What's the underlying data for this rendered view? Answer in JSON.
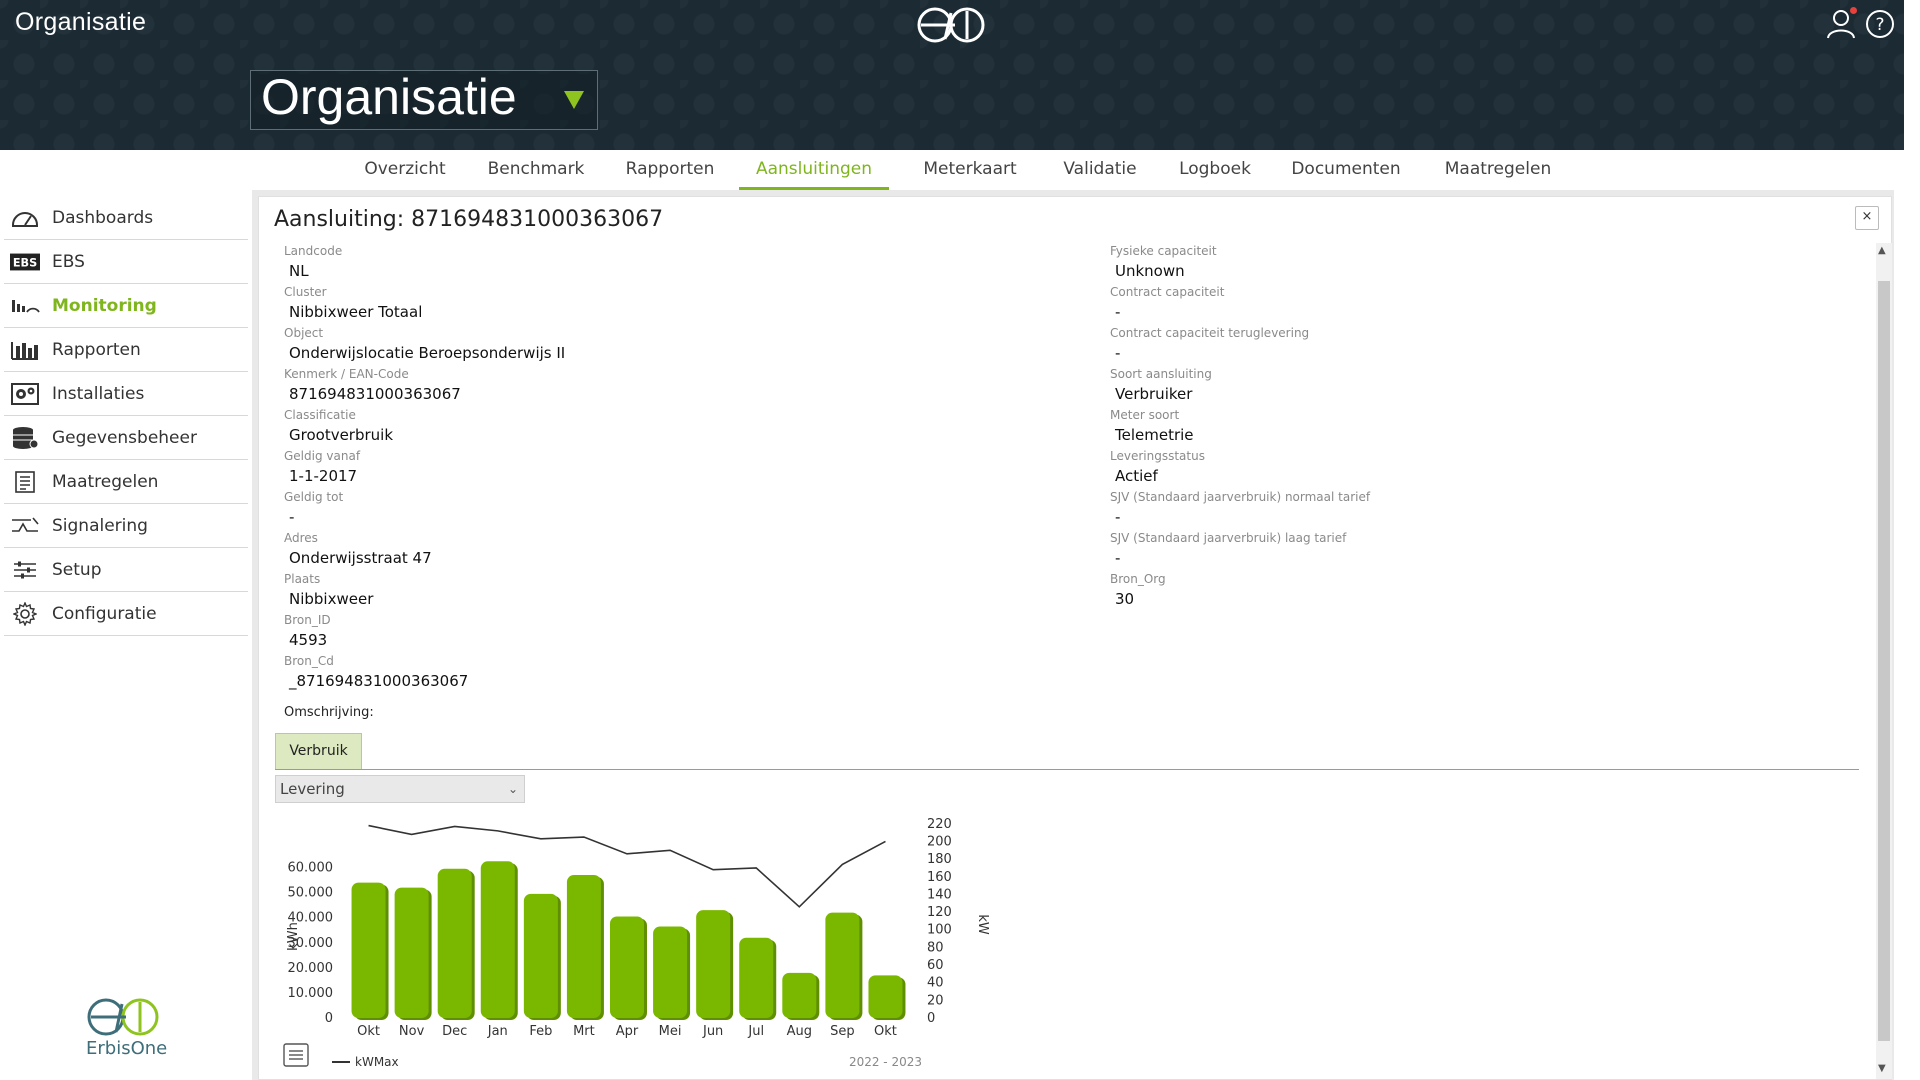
{
  "app": {
    "title": "Organisatie"
  },
  "org_selector": {
    "label": "Organisatie"
  },
  "colors": {
    "accent": "#7fb51d",
    "header_bg": "#1b2a33",
    "bar_green": "#7ab800"
  },
  "tabs": [
    {
      "label": "Overzicht"
    },
    {
      "label": "Benchmark"
    },
    {
      "label": "Rapporten"
    },
    {
      "label": "Aansluitingen",
      "active": true
    },
    {
      "label": "Meterkaart"
    },
    {
      "label": "Validatie"
    },
    {
      "label": "Logboek"
    },
    {
      "label": "Documenten"
    },
    {
      "label": "Maatregelen"
    }
  ],
  "sidebar": {
    "items": [
      {
        "label": "Dashboards",
        "icon": "gauge-icon"
      },
      {
        "label": "EBS",
        "icon": "ebs-icon"
      },
      {
        "label": "Monitoring",
        "icon": "monitoring-icon",
        "active": true
      },
      {
        "label": "Rapporten",
        "icon": "bar-chart-icon"
      },
      {
        "label": "Installaties",
        "icon": "installation-icon"
      },
      {
        "label": "Gegevensbeheer",
        "icon": "database-icon"
      },
      {
        "label": "Maatregelen",
        "icon": "checklist-icon"
      },
      {
        "label": "Signalering",
        "icon": "signal-icon"
      },
      {
        "label": "Setup",
        "icon": "sliders-icon"
      },
      {
        "label": "Configuratie",
        "icon": "gear-icon"
      }
    ],
    "brand": "ErbisOne"
  },
  "panel": {
    "title": "Aansluiting: 871694831000363067",
    "close_label": "×",
    "left_fields": [
      {
        "label": "Landcode",
        "value": "NL"
      },
      {
        "label": "Cluster",
        "value": "Nibbixweer Totaal"
      },
      {
        "label": "Object",
        "value": "Onderwijslocatie Beroepsonderwijs II"
      },
      {
        "label": "Kenmerk / EAN-Code",
        "value": "871694831000363067"
      },
      {
        "label": "Classificatie",
        "value": "Grootverbruik"
      },
      {
        "label": "Geldig vanaf",
        "value": "1-1-2017"
      },
      {
        "label": "Geldig tot",
        "value": "-"
      },
      {
        "label": "Adres",
        "value": "Onderwijsstraat 47"
      },
      {
        "label": "Plaats",
        "value": "Nibbixweer"
      },
      {
        "label": "Bron_ID",
        "value": "4593"
      },
      {
        "label": "Bron_Cd",
        "value": "_871694831000363067"
      }
    ],
    "right_fields": [
      {
        "label": "Fysieke capaciteit",
        "value": "Unknown"
      },
      {
        "label": "Contract capaciteit",
        "value": "-"
      },
      {
        "label": "Contract capaciteit teruglevering",
        "value": "-"
      },
      {
        "label": "Soort aansluiting",
        "value": "Verbruiker"
      },
      {
        "label": "Meter soort",
        "value": "Telemetrie"
      },
      {
        "label": "Leveringsstatus",
        "value": "Actief"
      },
      {
        "label": "SJV (Standaard jaarverbruik) normaal tarief",
        "value": "-"
      },
      {
        "label": "SJV (Standaard jaarverbruik) laag tarief",
        "value": "-"
      },
      {
        "label": "Bron_Org",
        "value": "30"
      }
    ],
    "description_label": "Omschrijving:",
    "sub_tab": "Verbruik",
    "select": {
      "value": "Levering",
      "options": [
        "Levering"
      ]
    }
  },
  "chart_data": {
    "type": "bar",
    "categories": [
      "Okt",
      "Nov",
      "Dec",
      "Jan",
      "Feb",
      "Mrt",
      "Apr",
      "Mei",
      "Jun",
      "Jul",
      "Aug",
      "Sep",
      "Okt"
    ],
    "series": [
      {
        "name": "",
        "type": "bar",
        "axis": "left",
        "values": [
          54000,
          52000,
          59500,
          62500,
          49500,
          57000,
          40500,
          36500,
          43000,
          32000,
          18000,
          42000,
          17000
        ]
      },
      {
        "name": "kWMax",
        "type": "line",
        "axis": "right",
        "values": [
          218,
          208,
          217,
          212,
          203,
          205,
          186,
          190,
          168,
          170,
          126,
          174,
          200
        ]
      }
    ],
    "ylabel": "kWh",
    "ylabel_right": "kW",
    "ylim": [
      0,
      65000
    ],
    "ylim_right": [
      0,
      230
    ],
    "yticks": [
      "0",
      "10.000",
      "20.000",
      "30.000",
      "40.000",
      "50.000",
      "60.000"
    ],
    "yticks_right": [
      "0",
      "20",
      "40",
      "60",
      "80",
      "100",
      "120",
      "140",
      "160",
      "180",
      "200",
      "220"
    ],
    "period_label": "2022 - 2023",
    "legend": {
      "placement": "bottom-left"
    },
    "grid": false
  }
}
